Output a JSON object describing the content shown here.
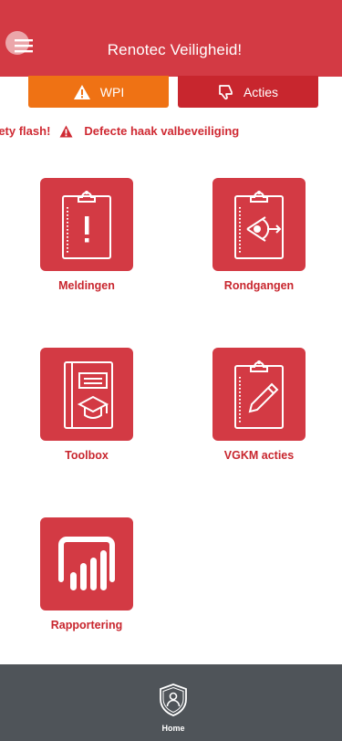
{
  "header": {
    "title": "Renotec Veiligheid!",
    "menu_icon": "hamburger-menu-icon",
    "background_color": "#d33a44"
  },
  "actions": {
    "wpi_label": "WPI",
    "wpi_icon": "warning-triangle-icon",
    "wpi_color": "#ef7214",
    "acties_label": "Acties",
    "acties_icon": "thumbs-down-icon",
    "acties_color": "#c8262e"
  },
  "ticker": {
    "prefix": "fety flash!",
    "message": "Defecte haak valbeveiliging",
    "icon": "warning-triangle-icon"
  },
  "tiles": [
    {
      "label": "Meldingen",
      "icon": "clipboard-exclamation-icon"
    },
    {
      "label": "Rondgangen",
      "icon": "clipboard-eye-icon"
    },
    {
      "label": "Toolbox",
      "icon": "toolbox-book-icon"
    },
    {
      "label": "VGKM acties",
      "icon": "clipboard-pencil-icon"
    },
    {
      "label": "Rapportering",
      "icon": "report-chart-icon"
    }
  ],
  "tabbar": {
    "home_label": "Home",
    "home_icon": "shield-user-icon",
    "background_color": "#4f5459"
  }
}
